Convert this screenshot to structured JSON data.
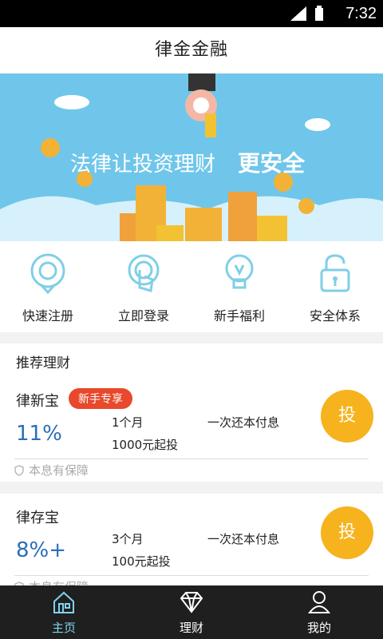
{
  "statusbar": {
    "time": "7:32",
    "icons": [
      "signal-icon",
      "battery-icon"
    ]
  },
  "app": {
    "title": "律金金融"
  },
  "banner": {
    "slogan_main": "法律让投资理财",
    "slogan_emph": "更安全"
  },
  "quick_actions": [
    {
      "label": "快速注册",
      "icon": "register-icon"
    },
    {
      "label": "立即登录",
      "icon": "login-touch-icon"
    },
    {
      "label": "新手福利",
      "icon": "lightbulb-icon"
    },
    {
      "label": "安全体系",
      "icon": "lock-icon"
    }
  ],
  "section": {
    "title": "推荐理财"
  },
  "products": [
    {
      "name": "律新宝",
      "badge": "新手专享",
      "rate": "11%",
      "term": "1个月",
      "min": "1000元起投",
      "repay": "一次还本付息",
      "action": "投",
      "guarantee": "本息有保障"
    },
    {
      "name": "律存宝",
      "badge": "",
      "rate": "8%+",
      "term": "3个月",
      "min": "100元起投",
      "repay": "一次还本付息",
      "action": "投",
      "guarantee": "本息有保障"
    }
  ],
  "tabs": [
    {
      "label": "主页",
      "icon": "home-icon",
      "active": true
    },
    {
      "label": "理财",
      "icon": "diamond-icon",
      "active": false
    },
    {
      "label": "我的",
      "icon": "user-icon",
      "active": false
    }
  ],
  "colors": {
    "accent_blue": "#2a6fb8",
    "badge_red": "#e8482b",
    "invest_orange": "#f6b31e",
    "tab_active": "#7fd3f0"
  }
}
